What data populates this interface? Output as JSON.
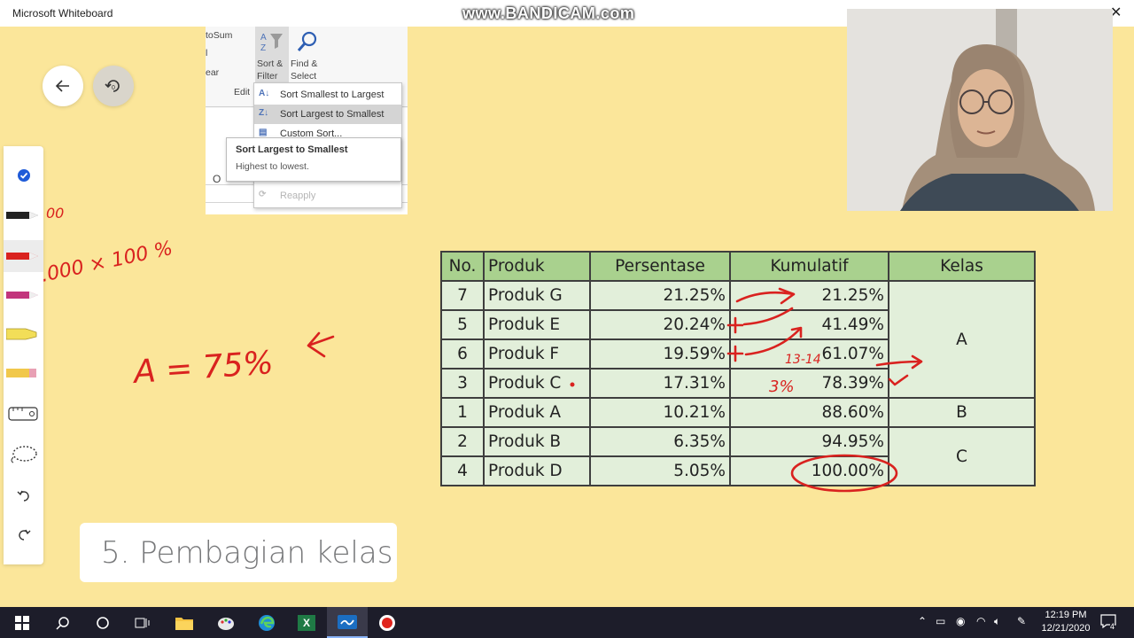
{
  "window": {
    "title": "Microsoft Whiteboard",
    "watermark": "www.BANDICAM.com",
    "close_label": "✕"
  },
  "excel_snapshot": {
    "ribbon": {
      "autosum_partial": "toSum",
      "fill_partial": "l",
      "clear_partial": "ear",
      "editing_partial": "Edit",
      "sort_filter_line1": "Sort &",
      "sort_filter_line2": "Filter",
      "find_select_line1": "Find &",
      "find_select_line2": "Select"
    },
    "menu": {
      "items": [
        {
          "label": "Sort Smallest to Largest",
          "icon": "sort-ascending-icon",
          "state": "normal"
        },
        {
          "label": "Sort Largest to Smallest",
          "icon": "sort-descending-icon",
          "state": "highlighted"
        },
        {
          "label": "Custom Sort...",
          "icon": "custom-sort-icon",
          "state": "normal"
        },
        {
          "label": "Reapply",
          "icon": "reapply-icon",
          "state": "disabled"
        }
      ]
    },
    "tooltip": {
      "title": "Sort Largest to Smallest",
      "description": "Highest to lowest."
    },
    "grid_column_label": "O"
  },
  "table": {
    "headers": [
      "No.",
      "Produk",
      "Persentase",
      "Kumulatif",
      "Kelas"
    ],
    "rows": [
      {
        "no": "7",
        "produk": "Produk G",
        "persentase": "21.25%",
        "kumulatif": "21.25%"
      },
      {
        "no": "5",
        "produk": "Produk E",
        "persentase": "20.24%",
        "kumulatif": "41.49%"
      },
      {
        "no": "6",
        "produk": "Produk F",
        "persentase": "19.59%",
        "kumulatif": "61.07%"
      },
      {
        "no": "3",
        "produk": "Produk C",
        "persentase": "17.31%",
        "kumulatif": "78.39%"
      },
      {
        "no": "1",
        "produk": "Produk A",
        "persentase": "10.21%",
        "kumulatif": "88.60%"
      },
      {
        "no": "2",
        "produk": "Produk B",
        "persentase": "6.35%",
        "kumulatif": "94.95%"
      },
      {
        "no": "4",
        "produk": "Produk D",
        "persentase": "5.05%",
        "kumulatif": "100.00%"
      }
    ],
    "kelas": [
      "A",
      "B",
      "C"
    ]
  },
  "section_label": "5. Pembagian kelas",
  "handwriting": {
    "formula_fragment_1": "00",
    "formula_fragment_2": ".000 × 100 %",
    "class_a_note": "A = 75%",
    "range_note": "13-14",
    "pct_note": "3%"
  },
  "colors": {
    "canvas": "#fbe69a",
    "ink_red": "#d9221f",
    "table_header": "#a9d18e",
    "table_cell": "#e2efda"
  },
  "taskbar": {
    "time": "12:19 PM",
    "date": "12/21/2020",
    "notification_count": "4",
    "excel_label": "X"
  }
}
